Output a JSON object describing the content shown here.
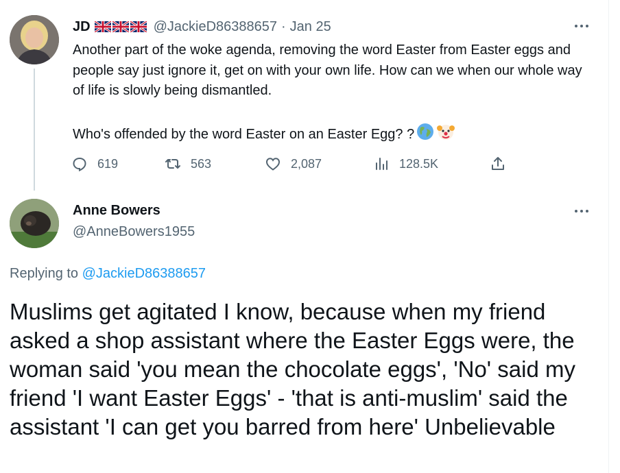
{
  "parent_tweet": {
    "author_name": "JD",
    "author_flags": [
      "uk-flag",
      "uk-flag",
      "uk-flag"
    ],
    "handle": "@JackieD86388657",
    "separator": "·",
    "date": "Jan 25",
    "text_paragraph_1": "Another part of the woke agenda, removing the word Easter from Easter eggs and people say just ignore it, get on with your own life. How can we when our whole way of life is slowly being dismantled.",
    "text_paragraph_2": "Who's offended by the word Easter on an Easter Egg? ?",
    "emojis": [
      "globe-emoji",
      "clown-emoji"
    ],
    "stats": {
      "replies": "619",
      "retweets": "563",
      "likes": "2,087",
      "views": "128.5K"
    }
  },
  "reply_tweet": {
    "author_name": "Anne Bowers",
    "handle": "@AnneBowers1955",
    "replying_prefix": "Replying to",
    "replying_to": "@JackieD86388657",
    "text": "Muslims get agitated I know, because when my friend asked a shop assistant where the Easter Eggs were, the woman said 'you mean the chocolate eggs', 'No' said my friend 'I want Easter Eggs' - 'that is anti-muslim' said the assistant 'I can get you barred from here' Unbelievable"
  },
  "colors": {
    "text_primary": "#0f1419",
    "text_secondary": "#536471",
    "link": "#1d9bf0",
    "thread_line": "#cfd9de"
  }
}
